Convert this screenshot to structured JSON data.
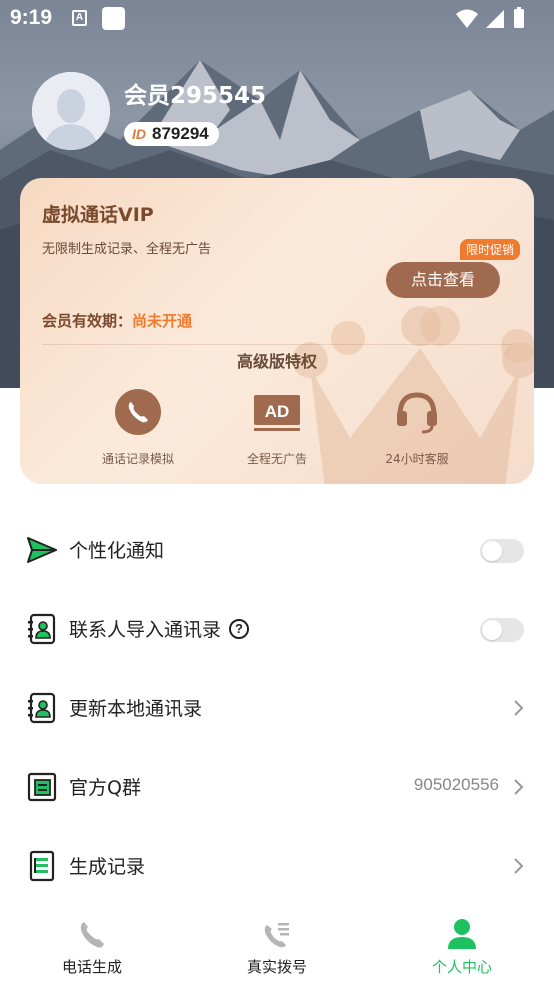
{
  "status_bar": {
    "time": "9:19",
    "notif_icon_letter": "A"
  },
  "profile": {
    "username": "会员295545",
    "id_tag": "ID",
    "id_number": "879294"
  },
  "vip_card": {
    "title": "虚拟通话VIP",
    "description": "无限制生成记录、全程无广告",
    "promo_badge": "限时促销",
    "view_button": "点击查看",
    "validity_label": "会员有效期：",
    "validity_value": "尚未开通",
    "privileges_title": "高级版特权",
    "ad_icon_text": "AD",
    "privileges": [
      {
        "label": "通话记录模拟",
        "icon": "phone-icon"
      },
      {
        "label": "全程无广告",
        "icon": "ad-icon"
      },
      {
        "label": "24小时客服",
        "icon": "headset-icon"
      }
    ]
  },
  "menu": [
    {
      "label": "个性化通知",
      "icon": "paper-plane-icon",
      "control": "toggle",
      "on": false
    },
    {
      "label": "联系人导入通讯录",
      "icon": "contact-book-icon",
      "control": "toggle",
      "on": false,
      "help": "?"
    },
    {
      "label": "更新本地通讯录",
      "icon": "contact-book-icon",
      "control": "chevron"
    },
    {
      "label": "官方Q群",
      "icon": "group-icon",
      "control": "chevron",
      "value": "905020556"
    },
    {
      "label": "生成记录",
      "icon": "record-icon",
      "control": "chevron"
    }
  ],
  "bottom_nav": [
    {
      "label": "电话生成",
      "icon": "phone-icon",
      "active": false
    },
    {
      "label": "真实拨号",
      "icon": "dial-icon",
      "active": false
    },
    {
      "label": "个人中心",
      "icon": "person-icon",
      "active": true
    }
  ],
  "colors": {
    "accent_green": "#1ec15f",
    "vip_brown": "#a06a4f",
    "promo_orange": "#f07a2e"
  }
}
